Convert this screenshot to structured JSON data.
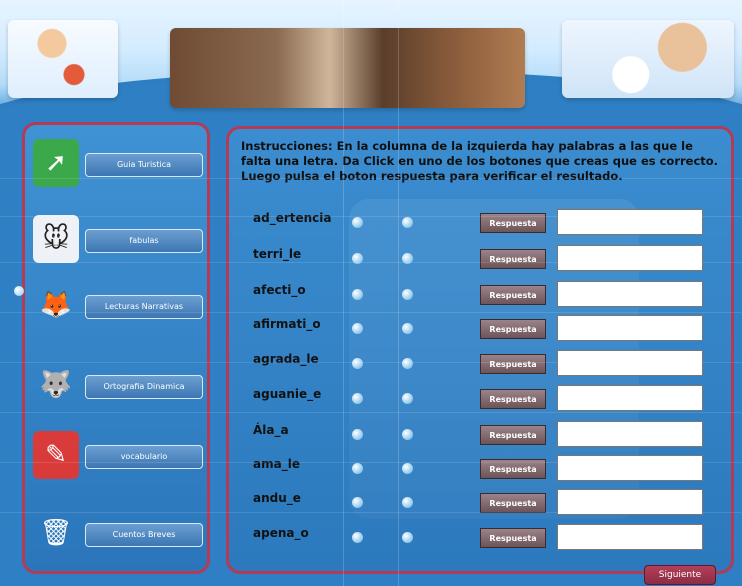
{
  "nav": {
    "items": [
      {
        "label": "Guia Turistica",
        "icon": "chart-arrow-icon",
        "color": "#38b24a"
      },
      {
        "label": "fabulas",
        "icon": "cartoon-mouse-icon",
        "color": "#f0f0f0"
      },
      {
        "label": "Lecturas Narrativas",
        "icon": "fox-character-icon",
        "color": "#d78a3a"
      },
      {
        "label": "Ortografia Dinamica",
        "icon": "gimp-mascot-icon",
        "color": "#8a6a3a"
      },
      {
        "label": "vocabulario",
        "icon": "red-document-icon",
        "color": "#d93b3b"
      },
      {
        "label": "Cuentos Breves",
        "icon": "trash-cartoon-icon",
        "color": "#9ec8ec"
      }
    ]
  },
  "exercise": {
    "instructions": "Instrucciones: En la columna de la izquierda hay palabras a las que le falta una letra. Da Click en uno de los botones que creas que es correcto. Luego pulsa el boton respuesta para verificar el resultado.",
    "response_label": "Respuesta",
    "rows": [
      {
        "word": "ad_ertencia",
        "answer": ""
      },
      {
        "word": "terri_le",
        "answer": ""
      },
      {
        "word": "afecti_o",
        "answer": ""
      },
      {
        "word": "afirmati_o",
        "answer": ""
      },
      {
        "word": "agrada_le",
        "answer": ""
      },
      {
        "word": "aguanie_e",
        "answer": ""
      },
      {
        "word": "Ála_a",
        "answer": ""
      },
      {
        "word": "ama_le",
        "answer": ""
      },
      {
        "word": "andu_e",
        "answer": ""
      },
      {
        "word": "apena_o",
        "answer": ""
      }
    ]
  },
  "footer": {
    "next_label": "Siguiente"
  },
  "colors": {
    "background": "#2f7fc4",
    "panel_border": "#b33b56",
    "response_button": "#7a6065",
    "next_button": "#a3364f"
  }
}
